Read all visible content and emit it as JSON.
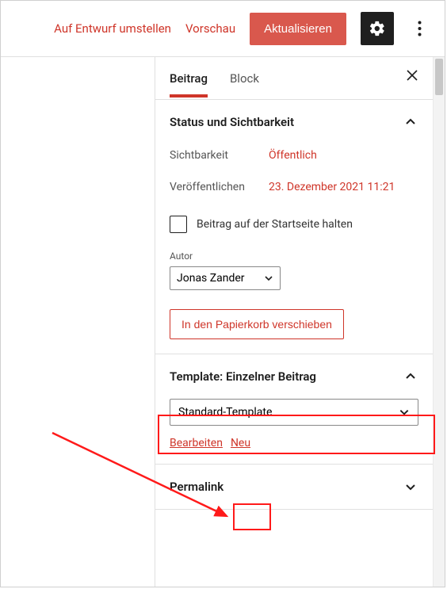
{
  "topbar": {
    "draft_label": "Auf Entwurf umstellen",
    "preview_label": "Vorschau",
    "update_label": "Aktualisieren"
  },
  "tabs": {
    "post": "Beitrag",
    "block": "Block"
  },
  "status_section": {
    "title": "Status und Sichtbarkeit",
    "visibility_label": "Sichtbarkeit",
    "visibility_value": "Öffentlich",
    "publish_label": "Veröffentlichen",
    "publish_value": "23. Dezember 2021 11:21",
    "sticky_label": "Beitrag auf der Startseite halten",
    "author_label": "Autor",
    "author_value": "Jonas Zander",
    "trash_label": "In den Papierkorb verschieben"
  },
  "template_section": {
    "title": "Template: Einzelner Beitrag",
    "select_value": "Standard-Template",
    "edit_label": "Bearbeiten",
    "new_label": "Neu"
  },
  "permalink_section": {
    "title": "Permalink"
  }
}
